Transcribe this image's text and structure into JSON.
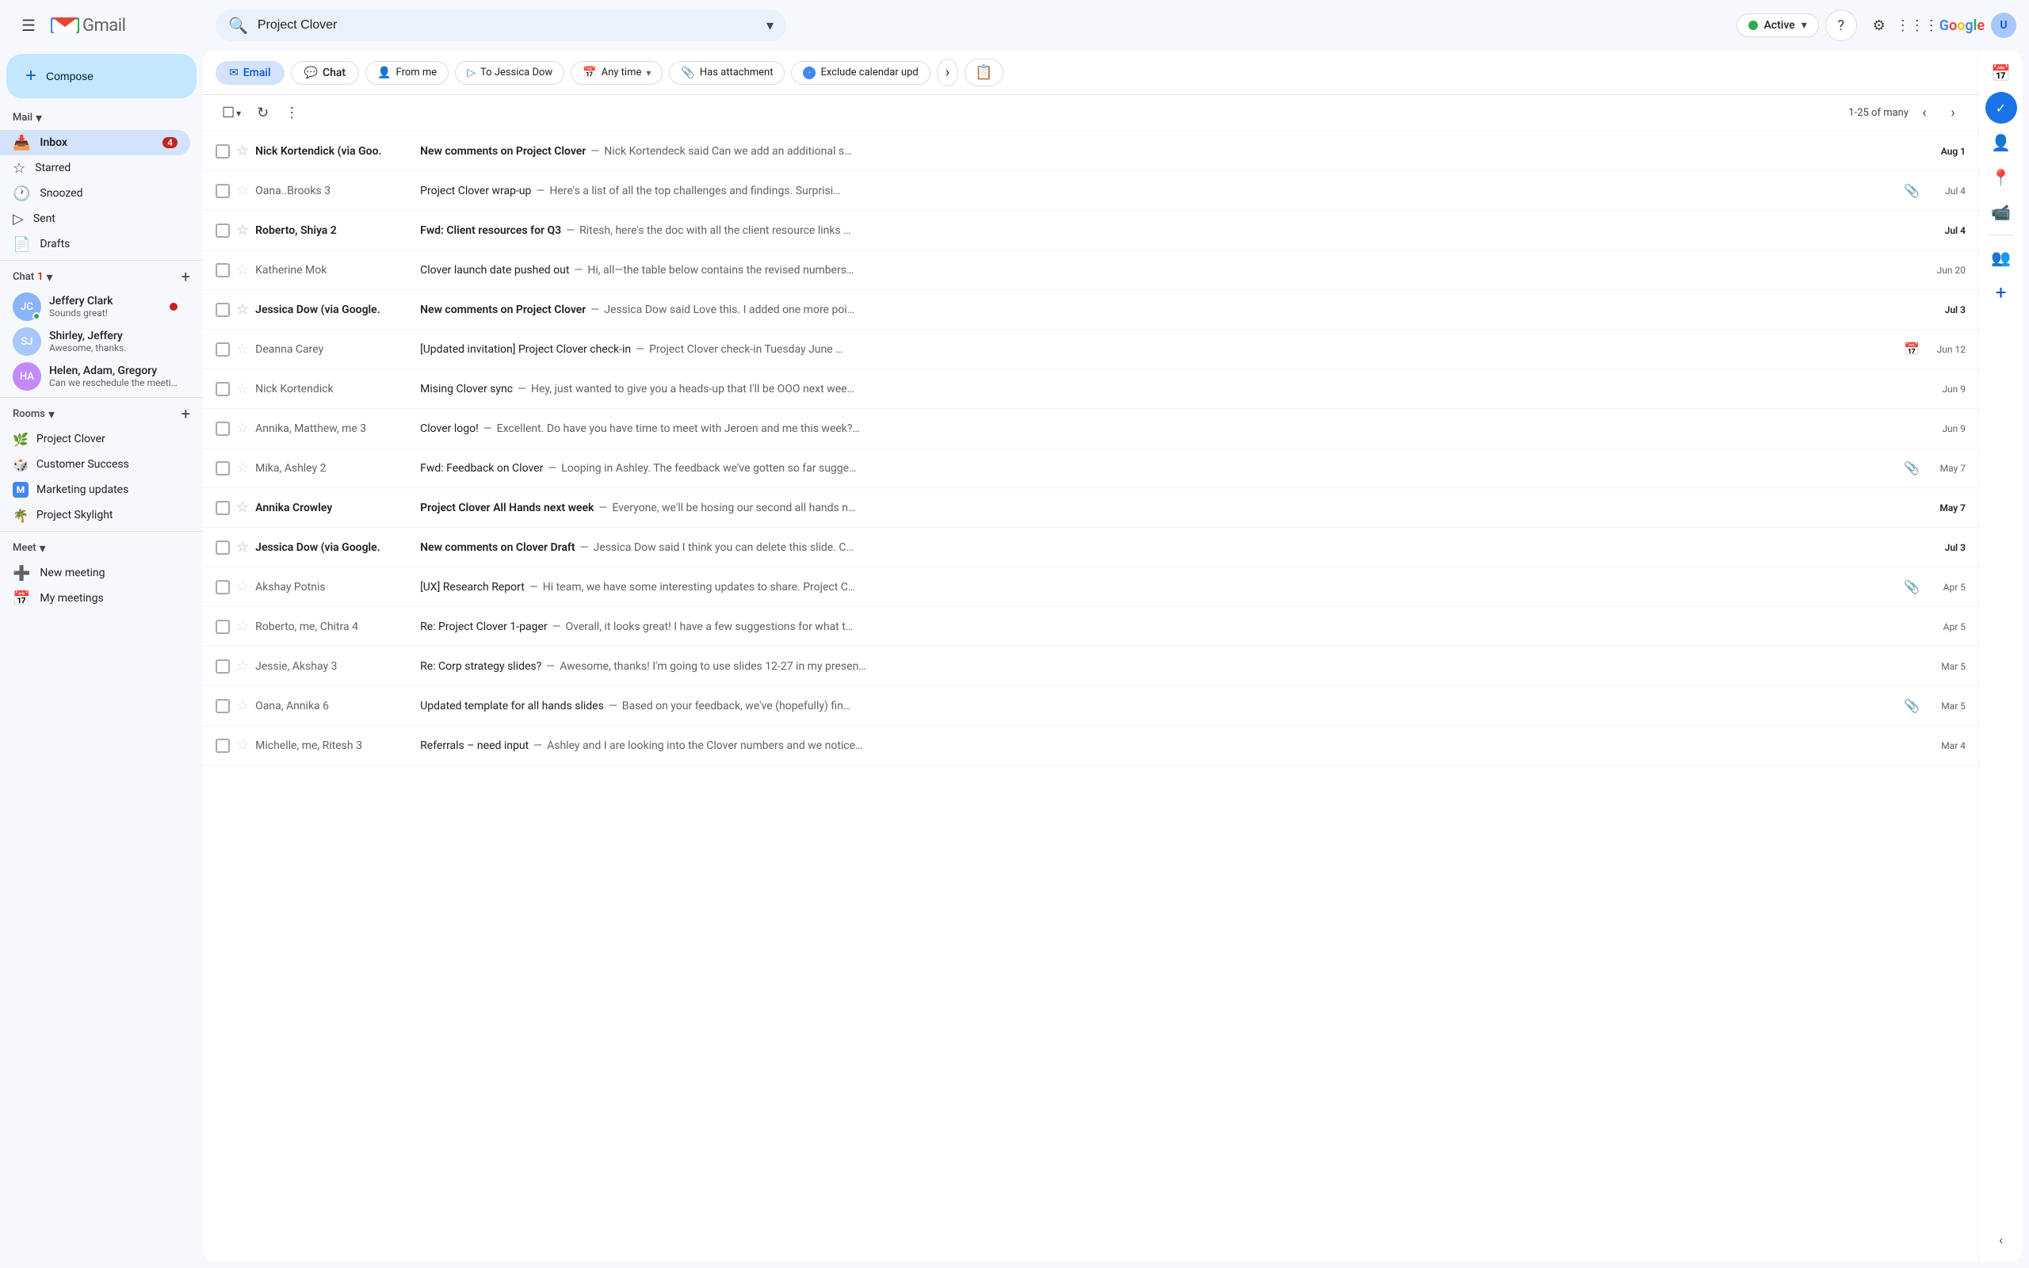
{
  "app": {
    "title": "Gmail",
    "logo_text": "Gmail"
  },
  "topbar": {
    "search_placeholder": "Project Clover",
    "search_value": "Project Clover",
    "status_label": "Active",
    "status_color": "#34a853",
    "help_icon": "?",
    "settings_icon": "⚙",
    "apps_icon": "⋮⋮⋮",
    "google_logo": "Google"
  },
  "compose": {
    "label": "Compose",
    "plus_icon": "+"
  },
  "nav": {
    "mail_section": "Mail",
    "inbox_label": "Inbox",
    "inbox_badge": "4",
    "starred_label": "Starred",
    "snoozed_label": "Snoozed",
    "sent_label": "Sent",
    "drafts_label": "Drafts",
    "chat_section": "Chat",
    "chat_badge": "1",
    "rooms_section": "Rooms",
    "meet_section": "Meet",
    "new_meeting_label": "New meeting",
    "my_meetings_label": "My meetings"
  },
  "chat_items": [
    {
      "name": "Jeffery Clark",
      "preview": "Sounds great!",
      "has_unread": true,
      "avatar_color": "#8ab4f8",
      "initials": "JC"
    },
    {
      "name": "Shirley, Jeffery",
      "preview": "Awesome, thanks.",
      "has_unread": false,
      "avatar_color": "#a8c7fa",
      "initials": "SJ"
    },
    {
      "name": "Helen, Adam, Gregory",
      "preview": "Can we reschedule the meeti...",
      "has_unread": false,
      "avatar_color": "#c58af9",
      "initials": "HA"
    }
  ],
  "rooms": [
    {
      "name": "Project Clover",
      "icon": "🌿"
    },
    {
      "name": "Customer Success",
      "icon": "🎲"
    },
    {
      "name": "Marketing updates",
      "icon": "🅼"
    },
    {
      "name": "Project Skylight",
      "icon": "🌴"
    }
  ],
  "filter_bar": {
    "email_tab": "Email",
    "chat_tab": "Chat",
    "from_me_chip": "From me",
    "to_jessica_chip": "To Jessica Dow",
    "any_time_chip": "Any time",
    "has_attachment_chip": "Has attachment",
    "exclude_calendar_chip": "Exclude calendar upd",
    "more_icon": "›"
  },
  "toolbar": {
    "select_all_icon": "☐",
    "refresh_icon": "↻",
    "more_icon": "⋮",
    "pagination_text": "1-25 of many",
    "prev_icon": "‹",
    "next_icon": "›"
  },
  "emails": [
    {
      "sender": "Nick Kortendick (via Goo.",
      "subject": "New comments on Project Clover",
      "snippet": "Nick Kortendeck said Can we add an additional s…",
      "date": "Aug 1",
      "unread": true,
      "starred": false,
      "has_attachment": false,
      "has_calendar": false
    },
    {
      "sender": "Oana..Brooks 3",
      "subject": "Project Clover wrap-up",
      "snippet": "Here's a list of all the top challenges and findings. Surprisi…",
      "date": "Jul 4",
      "unread": false,
      "starred": false,
      "has_attachment": true,
      "has_calendar": false
    },
    {
      "sender": "Roberto, Shiya 2",
      "subject": "Fwd: Client resources for Q3",
      "snippet": "Ritesh, here's the doc with all the client resource links …",
      "date": "Jul 4",
      "unread": true,
      "starred": false,
      "has_attachment": false,
      "has_calendar": false
    },
    {
      "sender": "Katherine Mok",
      "subject": "Clover launch date pushed out",
      "snippet": "Hi, all—the table below contains the revised numbers…",
      "date": "Jun 20",
      "unread": false,
      "starred": false,
      "has_attachment": false,
      "has_calendar": false
    },
    {
      "sender": "Jessica Dow (via Google.",
      "subject": "New comments on Project Clover",
      "snippet": "Jessica Dow said Love this. I added one more poi…",
      "date": "Jul 3",
      "unread": true,
      "starred": false,
      "has_attachment": false,
      "has_calendar": false
    },
    {
      "sender": "Deanna Carey",
      "subject": "[Updated invitation] Project Clover check-in",
      "snippet": "Project Clover check-in Tuesday June …",
      "date": "Jun 12",
      "unread": false,
      "starred": false,
      "has_attachment": false,
      "has_calendar": true
    },
    {
      "sender": "Nick Kortendick",
      "subject": "Mising Clover sync",
      "snippet": "Hey, just wanted to give you a heads-up that I'll be OOO next wee…",
      "date": "Jun 9",
      "unread": false,
      "starred": false,
      "has_attachment": false,
      "has_calendar": false
    },
    {
      "sender": "Annika, Matthew, me 3",
      "subject": "Clover logo!",
      "snippet": "Excellent. Do have you have time to meet with Jeroen and me this week?…",
      "date": "Jun 9",
      "unread": false,
      "starred": false,
      "has_attachment": false,
      "has_calendar": false
    },
    {
      "sender": "Mika, Ashley 2",
      "subject": "Fwd: Feedback on Clover",
      "snippet": "Looping in Ashley. The feedback we've gotten so far sugge…",
      "date": "May 7",
      "unread": false,
      "starred": false,
      "has_attachment": true,
      "has_calendar": false
    },
    {
      "sender": "Annika Crowley",
      "subject": "Project Clover All Hands next week",
      "snippet": "Everyone, we'll be hosing our second all hands n…",
      "date": "May 7",
      "unread": true,
      "starred": false,
      "has_attachment": false,
      "has_calendar": false
    },
    {
      "sender": "Jessica Dow (via Google.",
      "subject": "New comments on Clover Draft",
      "snippet": "Jessica Dow said I think you can delete this slide. C…",
      "date": "Jul 3",
      "unread": true,
      "starred": false,
      "has_attachment": false,
      "has_calendar": false
    },
    {
      "sender": "Akshay Potnis",
      "subject": "[UX] Research Report",
      "snippet": "Hi team, we have some interesting updates to share. Project C…",
      "date": "Apr 5",
      "unread": false,
      "starred": false,
      "has_attachment": true,
      "has_calendar": false
    },
    {
      "sender": "Roberto, me, Chitra 4",
      "subject": "Re: Project Clover 1-pager",
      "snippet": "Overall, it looks great! I have a few suggestions for what t…",
      "date": "Apr 5",
      "unread": false,
      "starred": false,
      "has_attachment": false,
      "has_calendar": false
    },
    {
      "sender": "Jessie, Akshay 3",
      "subject": "Re: Corp strategy slides?",
      "snippet": "Awesome, thanks! I'm going to use slides 12-27 in my presen…",
      "date": "Mar 5",
      "unread": false,
      "starred": false,
      "has_attachment": false,
      "has_calendar": false
    },
    {
      "sender": "Oana, Annika 6",
      "subject": "Updated template for all hands slides",
      "snippet": "Based on your feedback, we've (hopefully) fin…",
      "date": "Mar 5",
      "unread": false,
      "starred": false,
      "has_attachment": true,
      "has_calendar": false
    },
    {
      "sender": "Michelle, me, Ritesh 3",
      "subject": "Referrals – need input",
      "snippet": "Ashley and I are looking into the Clover numbers and we notice…",
      "date": "Mar 4",
      "unread": false,
      "starred": false,
      "has_attachment": false,
      "has_calendar": false
    }
  ],
  "right_sidebar": {
    "calendar_icon": "📅",
    "tasks_icon": "✓",
    "contacts_icon": "👤",
    "maps_icon": "📍",
    "meet_icon": "📹",
    "people_icon": "👥",
    "add_icon": "+"
  }
}
